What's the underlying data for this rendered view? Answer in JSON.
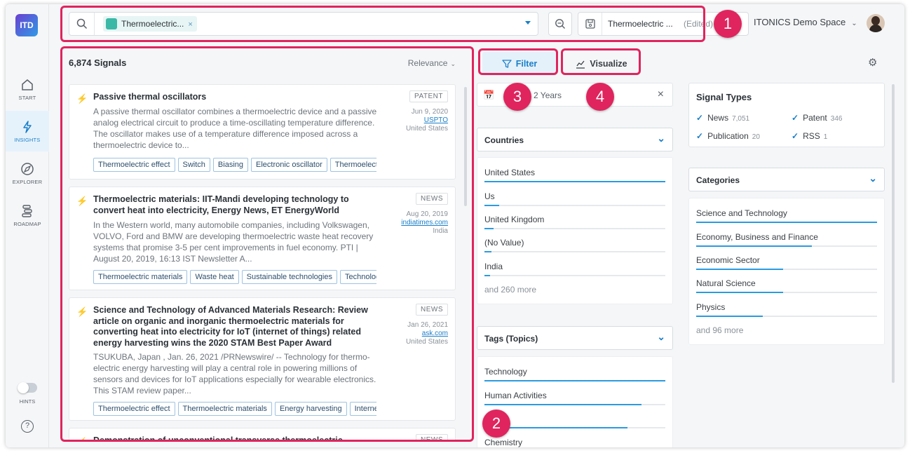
{
  "app": {
    "logo_text": "ITD"
  },
  "nav": {
    "items": [
      {
        "label": "START",
        "icon": "home-icon"
      },
      {
        "label": "INSIGHTS",
        "icon": "bolt-icon"
      },
      {
        "label": "EXPLORER",
        "icon": "compass-icon"
      },
      {
        "label": "ROADMAP",
        "icon": "roadmap-icon"
      }
    ],
    "hints_label": "HINTS",
    "help_label": "?"
  },
  "search": {
    "chip_label": "Thermoelectric...",
    "chip_remove": "×",
    "saved_name": "Thermoelectric ...",
    "saved_status": "(Edited)",
    "saved_clear": "×"
  },
  "workspace": {
    "name": "ITONICS Demo Space"
  },
  "callouts": [
    "1",
    "2",
    "3",
    "4"
  ],
  "results": {
    "count_label": "6,874 Signals",
    "sort_label": "Relevance",
    "cards": [
      {
        "title": "Passive thermal oscillators",
        "body": "A passive thermal oscillator combines a thermoelectric device and a pass­ive analog electrical circuit to produce a time-oscillating temperature dif­ference. The oscillator makes use of a temperature difference imposed across a thermoelectric device to...",
        "type": "PATENT",
        "date": "Jun 9, 2020",
        "source": "USPTO",
        "country": "United States",
        "tags": [
          "Thermoelectric effect",
          "Switch",
          "Biasing",
          "Electronic oscillator",
          "Thermoelectric"
        ]
      },
      {
        "title": "Thermoelectric materials: IIT-Mandi developing technology to convert heat into electricity, Energy News, ET EnergyWorld",
        "body": "In the Western world, many automobile companies, including Volkswagen, VOLVO, Ford and BMW are developing thermoelectric waste heat recovery systems that promise 3-5 per cent improvements in fuel economy. PTI | August 20, 2019, 16:13 IST Newsletter A...",
        "type": "NEWS",
        "date": "Aug 20, 2019",
        "source": "indiatimes.com",
        "country": "India",
        "tags": [
          "Thermoelectric materials",
          "Waste heat",
          "Sustainable technologies",
          "Technology"
        ]
      },
      {
        "title": "Science and Technology of Advanced Materials Research: Review article on organic and inorganic thermoelectric materials for converting heat into electricity for IoT (internet of things) related energy harvesting wins the 2020 STAM Best Paper Award",
        "body": "TSUKUBA, Japan , Jan. 26, 2021 /PRNewswire/ -- Technology for thermo­electric energy harvesting will play a central role in powering millions of sensors and devices for IoT applications especially for wearable electron­ics. This STAM review paper...",
        "type": "NEWS",
        "date": "Jan 26, 2021",
        "source": "ask.com",
        "country": "United States",
        "tags": [
          "Thermoelectric effect",
          "Thermoelectric materials",
          "Energy harvesting",
          "Internet"
        ]
      },
      {
        "title": "Demonstration of unconventional transverse thermoelectric",
        "type": "NEWS"
      }
    ]
  },
  "toolbar": {
    "filter_label": "Filter",
    "visualize_label": "Visualize"
  },
  "filters": {
    "date_value": "2 Years",
    "date_clear": "×",
    "countries": {
      "label": "Countries",
      "rows": [
        {
          "name": "United States",
          "share": 1.0
        },
        {
          "name": "Us",
          "share": 0.08
        },
        {
          "name": "United Kingdom",
          "share": 0.05
        },
        {
          "name": "(No Value)",
          "share": 0.04
        },
        {
          "name": "India",
          "share": 0.03
        }
      ],
      "more": "and 260 more"
    },
    "tags": {
      "label": "Tags (Topics)",
      "rows": [
        {
          "name": "Technology",
          "share": 1.0
        },
        {
          "name": "Human Activities",
          "share": 0.87
        },
        {
          "name": "",
          "share": 0.79
        },
        {
          "name": "Chemistry",
          "share": 0.5
        }
      ]
    },
    "signal_types": {
      "label": "Signal Types",
      "items": [
        {
          "name": "News",
          "count": "7,051"
        },
        {
          "name": "Patent",
          "count": "346"
        },
        {
          "name": "Publication",
          "count": "20"
        },
        {
          "name": "RSS",
          "count": "1"
        }
      ]
    },
    "categories": {
      "label": "Categories",
      "rows": [
        {
          "name": "Science and Technology",
          "share": 1.0
        },
        {
          "name": "Economy, Business and Finance",
          "share": 0.64
        },
        {
          "name": "Economic Sector",
          "share": 0.48
        },
        {
          "name": "Natural Science",
          "share": 0.48
        },
        {
          "name": "Physics",
          "share": 0.37
        }
      ],
      "more": "and 96 more"
    }
  },
  "colors": {
    "accent": "#1a7fc9",
    "callout": "#e0245e",
    "bar": "#2b9be0"
  }
}
